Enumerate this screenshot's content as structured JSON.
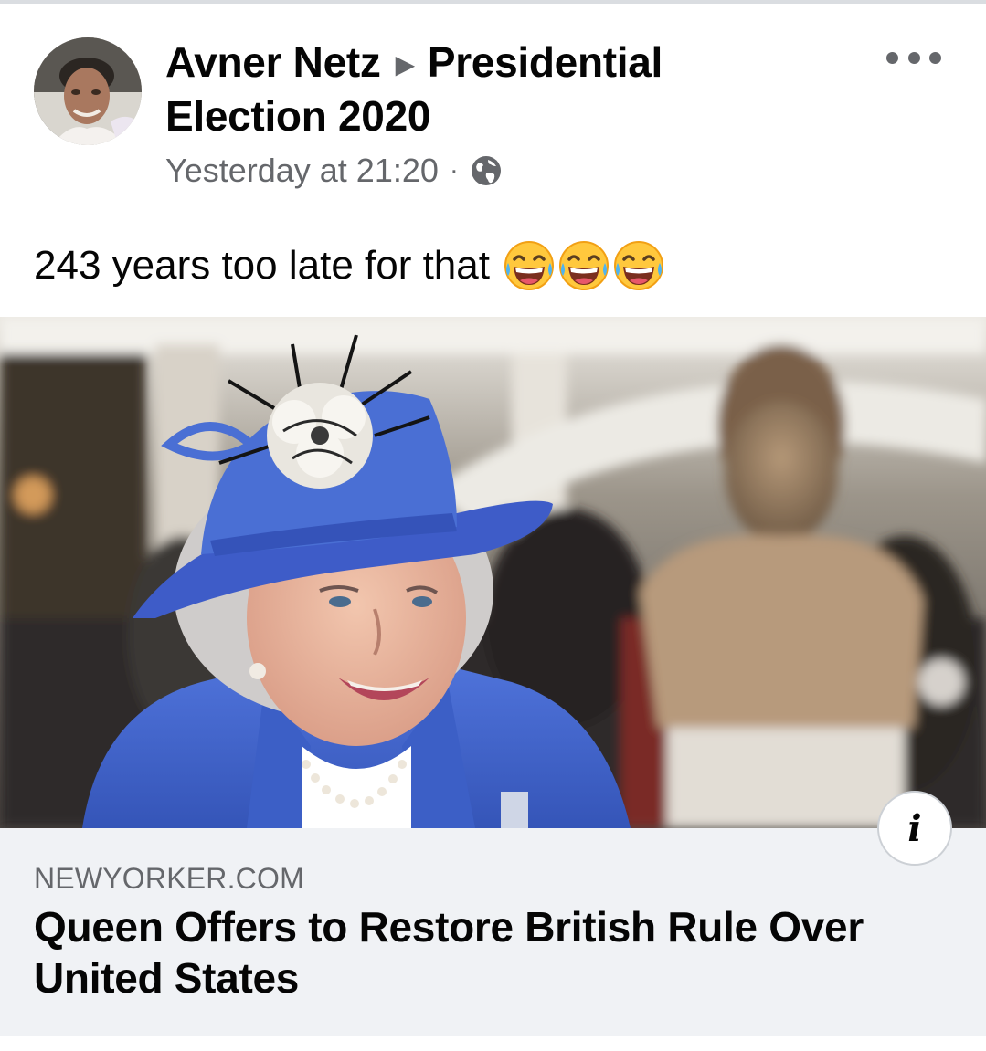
{
  "post": {
    "author": "Avner Netz",
    "group": "Presidential Election 2020",
    "group_line1": "Presidential",
    "group_line2": "Election 2020",
    "timestamp": "Yesterday at 21:20",
    "separator": "·",
    "audience_icon": "globe-icon",
    "text": "243 years too late for that",
    "emojis": [
      "face-with-tears-of-joy",
      "face-with-tears-of-joy",
      "face-with-tears-of-joy"
    ],
    "more_icon": "more-options-icon"
  },
  "link": {
    "domain": "NEWYORKER.COM",
    "headline": "Queen Offers to Restore British Rule Over United States",
    "info_label": "i"
  },
  "colors": {
    "text_primary": "#050505",
    "text_secondary": "#65676b",
    "caption_bg": "#f0f2f5",
    "hat_blue": "#4a6fd4"
  }
}
